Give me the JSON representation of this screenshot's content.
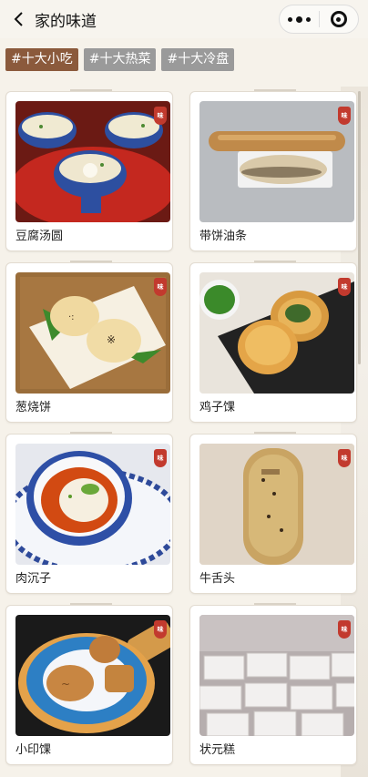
{
  "header": {
    "title": "家的味道",
    "back_icon": "chevron-left-icon",
    "more_icon": "more-dots-icon",
    "close_icon": "target-close-icon"
  },
  "tags": [
    {
      "label": "#十大小吃",
      "active": true
    },
    {
      "label": "#十大热菜",
      "active": false
    },
    {
      "label": "#十大冷盘",
      "active": false
    }
  ],
  "colors": {
    "active_tag": "#8b5a3c",
    "inactive_tag": "#9a9a9a",
    "badge": "#c23a2e",
    "page_bg": "#f6f2ea"
  },
  "items": [
    {
      "name": "豆腐汤圆"
    },
    {
      "name": "带饼油条"
    },
    {
      "name": "葱烧饼"
    },
    {
      "name": "鸡子馃"
    },
    {
      "name": "肉沉子"
    },
    {
      "name": "牛舌头"
    },
    {
      "name": "小印馃"
    },
    {
      "name": "状元糕"
    }
  ]
}
